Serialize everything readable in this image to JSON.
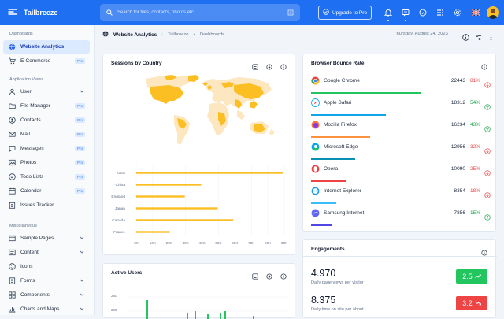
{
  "app": {
    "name": "Tailbreeze"
  },
  "search": {
    "placeholder": "Search for files, contacts, photos etc."
  },
  "header": {
    "upgrade_label": "Upgrade to Pro"
  },
  "sidebar": {
    "section1": "Dashboards",
    "section2": "Application Views",
    "section3": "Miscellaneous",
    "pro_label": "Pro",
    "items": [
      {
        "label": "Website Analytics"
      },
      {
        "label": "E-Commerce"
      },
      {
        "label": "User"
      },
      {
        "label": "File Manager"
      },
      {
        "label": "Contacts"
      },
      {
        "label": "Mail"
      },
      {
        "label": "Messages"
      },
      {
        "label": "Photos"
      },
      {
        "label": "Todo Lists"
      },
      {
        "label": "Calendar"
      },
      {
        "label": "Issues Tracker"
      },
      {
        "label": "Sample Pages"
      },
      {
        "label": "Content"
      },
      {
        "label": "Icons"
      },
      {
        "label": "Forms"
      },
      {
        "label": "Components"
      },
      {
        "label": "Charts and Maps"
      }
    ]
  },
  "breadcrumb": {
    "title": "Website Analytics",
    "crumb1": "Tailbreeze",
    "crumb2": "Dashboards",
    "date": "Thursday, August 24, 2023"
  },
  "sessions": {
    "title": "Sessions by Country"
  },
  "chart_data": {
    "type": "bar",
    "orientation": "horizontal",
    "title": "Sessions by Country",
    "categories": [
      "USA",
      "China",
      "England",
      "Japan",
      "Canada",
      "France"
    ],
    "values": [
      89000,
      39500,
      29500,
      49500,
      59000,
      20500
    ],
    "xticks": [
      "0K",
      "10K",
      "20K",
      "30K",
      "40K",
      "50K",
      "60K",
      "70K",
      "80K",
      "90K"
    ],
    "xlim": [
      0,
      90000
    ],
    "color": "#fbbf24"
  },
  "bounce": {
    "title": "Browser Bounce Rate",
    "rows": [
      {
        "name": "Google Chrome",
        "value": "22443",
        "pct": "81%",
        "trend": "down",
        "color": "#22c55e",
        "bar": 0.8
      },
      {
        "name": "Apple Safari",
        "value": "18312",
        "pct": "54%",
        "trend": "up",
        "color": "#0ea5e9",
        "bar": 0.54
      },
      {
        "name": "Mozilla Firefox",
        "value": "16234",
        "pct": "43%",
        "trend": "up",
        "color": "#fb923c",
        "bar": 0.43
      },
      {
        "name": "Microsoft Edge",
        "value": "12956",
        "pct": "32%",
        "trend": "down",
        "color": "#0891b2",
        "bar": 0.32
      },
      {
        "name": "Opera",
        "value": "10090",
        "pct": "25%",
        "trend": "down",
        "color": "#ef4444",
        "bar": 0.25
      },
      {
        "name": "Internet Explorer",
        "value": "8354",
        "pct": "18%",
        "trend": "down",
        "color": "#38bdf8",
        "bar": 0.18
      },
      {
        "name": "Samsung Internet",
        "value": "7856",
        "pct": "15%",
        "trend": "up",
        "color": "#4f46e5",
        "bar": 0.15
      }
    ]
  },
  "engagements": {
    "title": "Engagements",
    "rows": [
      {
        "big": "4.970",
        "sub": "Daily page views per visitor",
        "badge": "2.5",
        "color": "#22c55e"
      },
      {
        "big": "8.375",
        "sub": "Daily time on site per about",
        "badge": "3.2",
        "color": "#ef4444"
      }
    ]
  },
  "active_users": {
    "title": "Active Users",
    "y_ticks": [
      "250",
      "200"
    ]
  }
}
